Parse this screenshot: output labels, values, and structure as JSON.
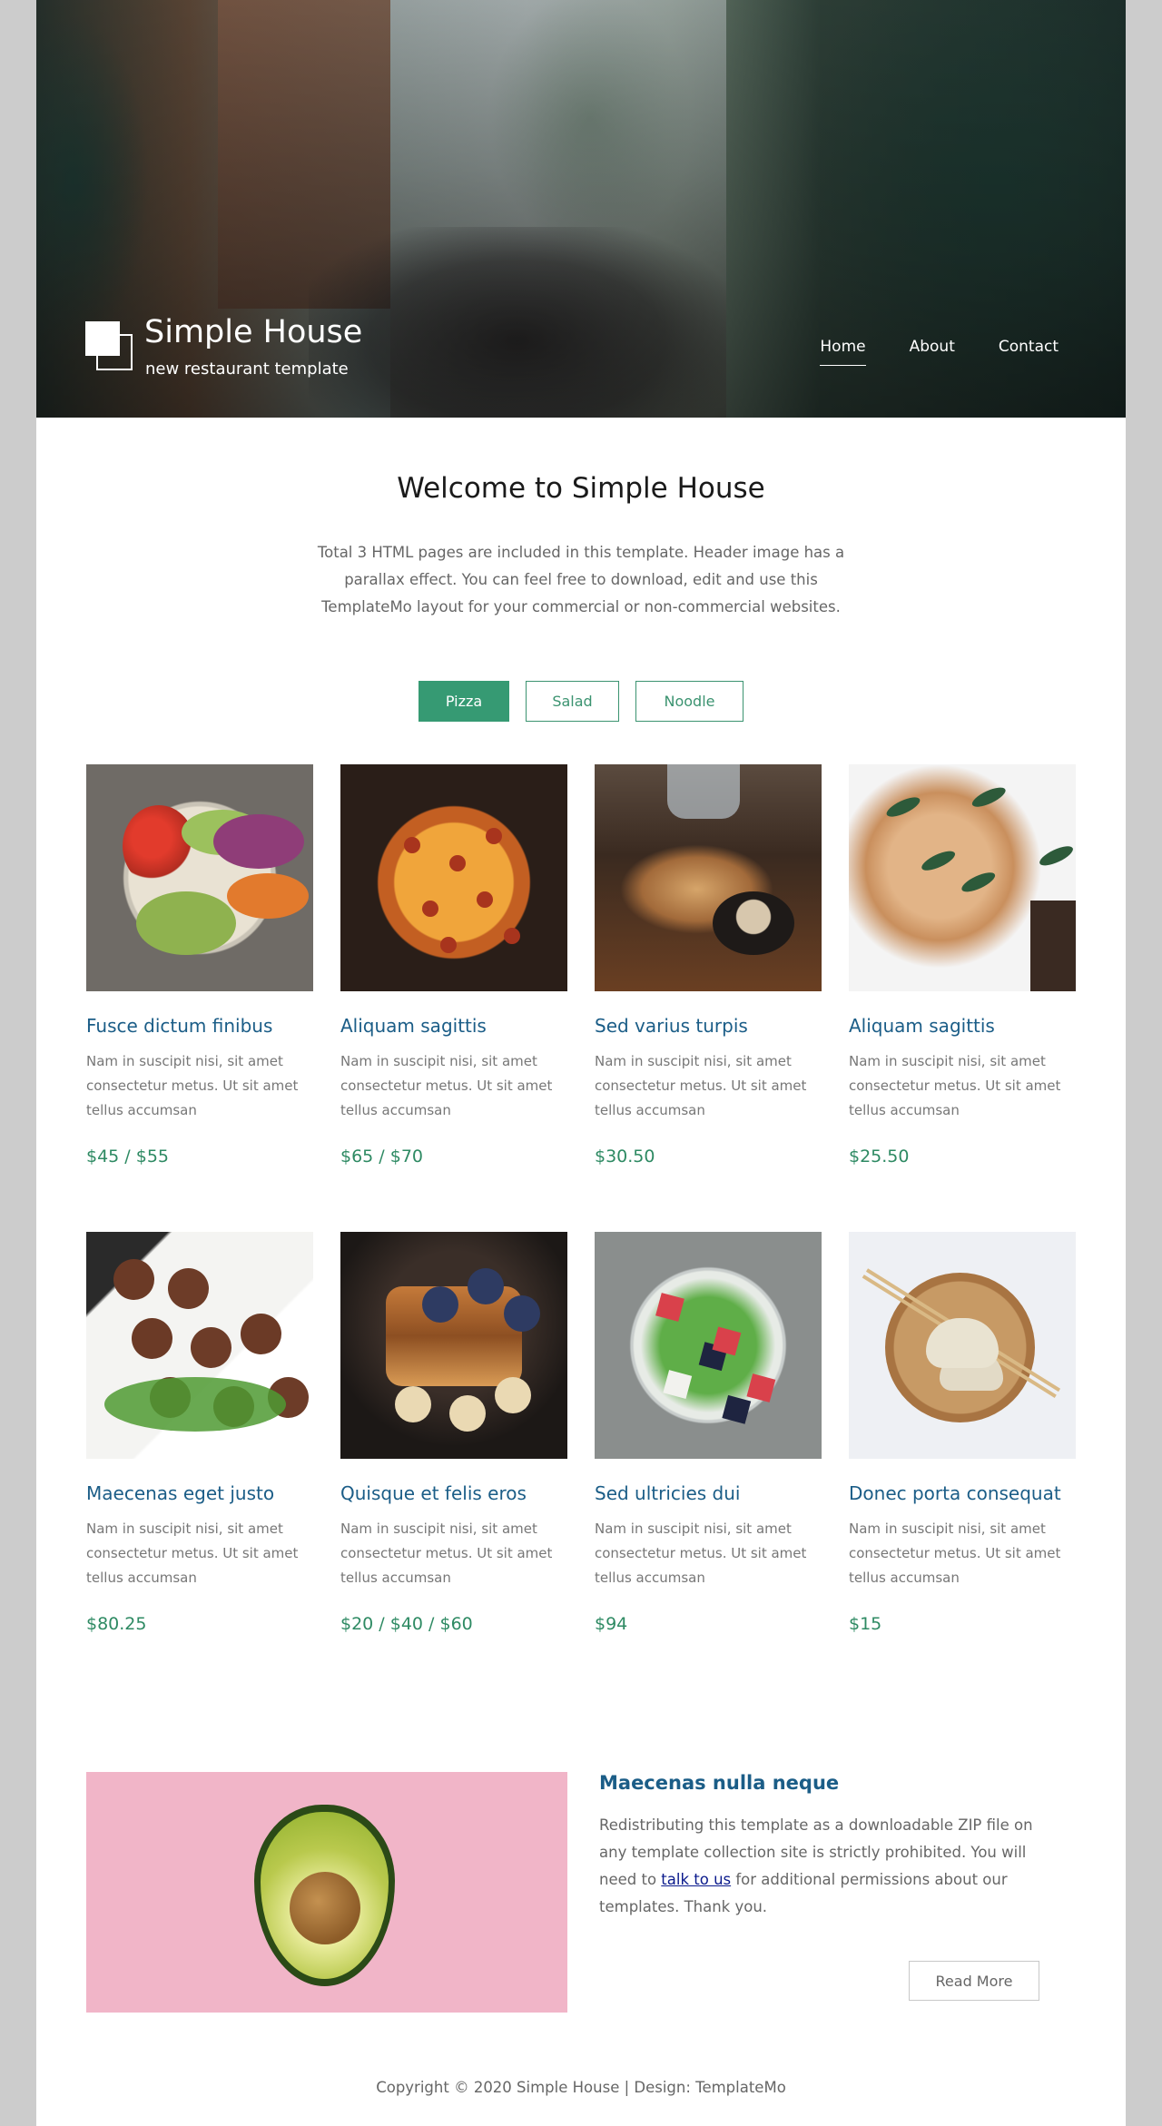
{
  "header": {
    "brand_title": "Simple House",
    "brand_tagline": "new restaurant template",
    "nav": [
      {
        "label": "Home",
        "active": true
      },
      {
        "label": "About",
        "active": false
      },
      {
        "label": "Contact",
        "active": false
      }
    ]
  },
  "welcome": {
    "title": "Welcome to Simple House",
    "text": "Total 3 HTML pages are included in this template. Header image has a parallax effect. You can feel free to download, edit and use this TemplateMo layout for your commercial or non-commercial websites."
  },
  "tabs": [
    {
      "label": "Pizza",
      "active": true
    },
    {
      "label": "Salad",
      "active": false
    },
    {
      "label": "Noodle",
      "active": false
    }
  ],
  "menu_items": [
    {
      "title": "Fusce dictum finibus",
      "desc": "Nam in suscipit nisi, sit amet consectetur metus. Ut sit amet tellus accumsan",
      "price": "$45 / $55",
      "image": "salad-bowl"
    },
    {
      "title": "Aliquam sagittis",
      "desc": "Nam in suscipit nisi, sit amet consectetur metus. Ut sit amet tellus accumsan",
      "price": "$65 / $70",
      "image": "pizza"
    },
    {
      "title": "Sed varius turpis",
      "desc": "Nam in suscipit nisi, sit amet consectetur metus. Ut sit amet tellus accumsan",
      "price": "$30.50",
      "image": "grilled-wings"
    },
    {
      "title": "Aliquam sagittis",
      "desc": "Nam in suscipit nisi, sit amet consectetur metus. Ut sit amet tellus accumsan",
      "price": "$25.50",
      "image": "pasta"
    },
    {
      "title": "Maecenas eget justo",
      "desc": "Nam in suscipit nisi, sit amet consectetur metus. Ut sit amet tellus accumsan",
      "price": "$80.25",
      "image": "meatballs"
    },
    {
      "title": "Quisque et felis eros",
      "desc": "Nam in suscipit nisi, sit amet consectetur metus. Ut sit amet tellus accumsan",
      "price": "$20 / $40 / $60",
      "image": "french-toast"
    },
    {
      "title": "Sed ultricies dui",
      "desc": "Nam in suscipit nisi, sit amet consectetur metus. Ut sit amet tellus accumsan",
      "price": "$94",
      "image": "greek-salad"
    },
    {
      "title": "Donec porta consequat",
      "desc": "Nam in suscipit nisi, sit amet consectetur metus. Ut sit amet tellus accumsan",
      "price": "$15",
      "image": "dumplings"
    }
  ],
  "about": {
    "title": "Maecenas nulla neque",
    "text_before": "Redistributing this template as a downloadable ZIP file on any template collection site is strictly prohibited. You will need to ",
    "link_text": "talk to us",
    "text_after": " for additional permissions about our templates. Thank you.",
    "button_label": "Read More"
  },
  "footer": {
    "copyright": "Copyright © 2020 Simple House | Design: TemplateMo"
  },
  "colors": {
    "accent_green": "#369a73",
    "title_blue": "#1b5d87",
    "price_green": "#2e8a63",
    "page_bg": "#cccccc"
  }
}
